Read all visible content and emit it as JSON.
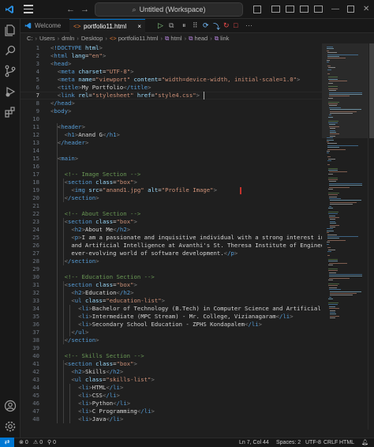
{
  "window": {
    "search_text": "Untitled (Workspace)",
    "accent": "#0078d4"
  },
  "tabs": [
    {
      "label": "Welcome",
      "active": false,
      "icon": "vscode-logo-icon"
    },
    {
      "label": "portfolio11.html",
      "active": true,
      "icon": "html-file-icon"
    }
  ],
  "breadcrumb": [
    "C:",
    "Users",
    "dmln",
    "Desktop",
    "portfolio11.html",
    "html",
    "head",
    "link"
  ],
  "activity_icons": [
    "explorer-icon",
    "search-icon",
    "source-control-icon",
    "run-debug-icon",
    "extensions-icon",
    "account-icon",
    "settings-gear-icon"
  ],
  "editor": {
    "cursor_line": 7,
    "lines": [
      {
        "n": "1",
        "t": "<!DOCTYPE html>"
      },
      {
        "n": "2",
        "t": "<html lang=\"en\">"
      },
      {
        "n": "3",
        "t": "<head>"
      },
      {
        "n": "4",
        "t": "  <meta charset=\"UTF-8\">"
      },
      {
        "n": "5",
        "t": "  <meta name=\"viewport\" content=\"width=device-width, initial-scale=1.0\">"
      },
      {
        "n": "6",
        "t": "  <title>My Portfolio</title>"
      },
      {
        "n": "7",
        "t": "  <link rel=\"stylesheet\" href=\"style4.css\">"
      },
      {
        "n": "8",
        "t": "</head>"
      },
      {
        "n": "9",
        "t": "<body>"
      },
      {
        "n": "10",
        "t": ""
      },
      {
        "n": "11",
        "t": "  <header>"
      },
      {
        "n": "12",
        "t": "    <h1>Anand G</h1>"
      },
      {
        "n": "13",
        "t": "  </header>"
      },
      {
        "n": "14",
        "t": ""
      },
      {
        "n": "15",
        "t": "  <main>"
      },
      {
        "n": "16",
        "t": ""
      },
      {
        "n": "17",
        "t": "    <!-- Image Section -->"
      },
      {
        "n": "18",
        "t": "    <section class=\"box\">"
      },
      {
        "n": "19",
        "t": "      <img src=\"anand1.jpg\" alt=\"Profile Image\">"
      },
      {
        "n": "20",
        "t": "    </section>"
      },
      {
        "n": "21",
        "t": ""
      },
      {
        "n": "22",
        "t": "    <!-- About Section -->"
      },
      {
        "n": "23",
        "t": "    <section class=\"box\">"
      },
      {
        "n": "24",
        "t": "      <h2>About Me</h2>"
      },
      {
        "n": "25",
        "t": "      <p>I am a passionate and inquisitive individual with a strong interest in te"
      },
      {
        "n": "26",
        "t": "      and Artificial Intelligence at Avanthi's St. Theresa Institute of Engineerin"
      },
      {
        "n": "27",
        "t": "      ever-evolving world of software development.</p>"
      },
      {
        "n": "28",
        "t": "    </section>"
      },
      {
        "n": "29",
        "t": ""
      },
      {
        "n": "30",
        "t": "    <!-- Education Section -->"
      },
      {
        "n": "31",
        "t": "    <section class=\"box\">"
      },
      {
        "n": "32",
        "t": "      <h2>Education</h2>"
      },
      {
        "n": "33",
        "t": "      <ul class=\"education-list\">"
      },
      {
        "n": "34",
        "t": "        <li>Bachelor of Technology (B.Tech) in Computer Science and Artificial I"
      },
      {
        "n": "35",
        "t": "        <li>Intermediate (MPC Stream) - Mr. College, Vizianagaram</li>"
      },
      {
        "n": "36",
        "t": "        <li>Secondary School Education - ZPHS Kondapalem</li>"
      },
      {
        "n": "37",
        "t": "      </ul>"
      },
      {
        "n": "38",
        "t": "    </section>"
      },
      {
        "n": "39",
        "t": ""
      },
      {
        "n": "40",
        "t": "    <!-- Skills Section -->"
      },
      {
        "n": "41",
        "t": "    <section class=\"box\">"
      },
      {
        "n": "42",
        "t": "      <h2>Skills</h2>"
      },
      {
        "n": "43",
        "t": "      <ul class=\"skills-list\">"
      },
      {
        "n": "44",
        "t": "        <li>HTML</li>"
      },
      {
        "n": "45",
        "t": "        <li>CSS</li>"
      },
      {
        "n": "46",
        "t": "        <li>Python</li>"
      },
      {
        "n": "47",
        "t": "        <li>C Programming</li>"
      },
      {
        "n": "48",
        "t": "        <li>Java</li>"
      }
    ]
  },
  "status": {
    "errors": "0",
    "warnings": "0",
    "ports": "0",
    "cursor": "Ln 7, Col 44",
    "spaces": "Spaces: 2",
    "encoding": "UTF-8",
    "eol": "CRLF",
    "language": "HTML"
  },
  "colors": {
    "tag": "#569cd6",
    "attribute": "#9cdcfe",
    "string": "#ce9178",
    "comment": "#6a9955",
    "bracket": "#808080",
    "text": "#d4d4d4"
  }
}
